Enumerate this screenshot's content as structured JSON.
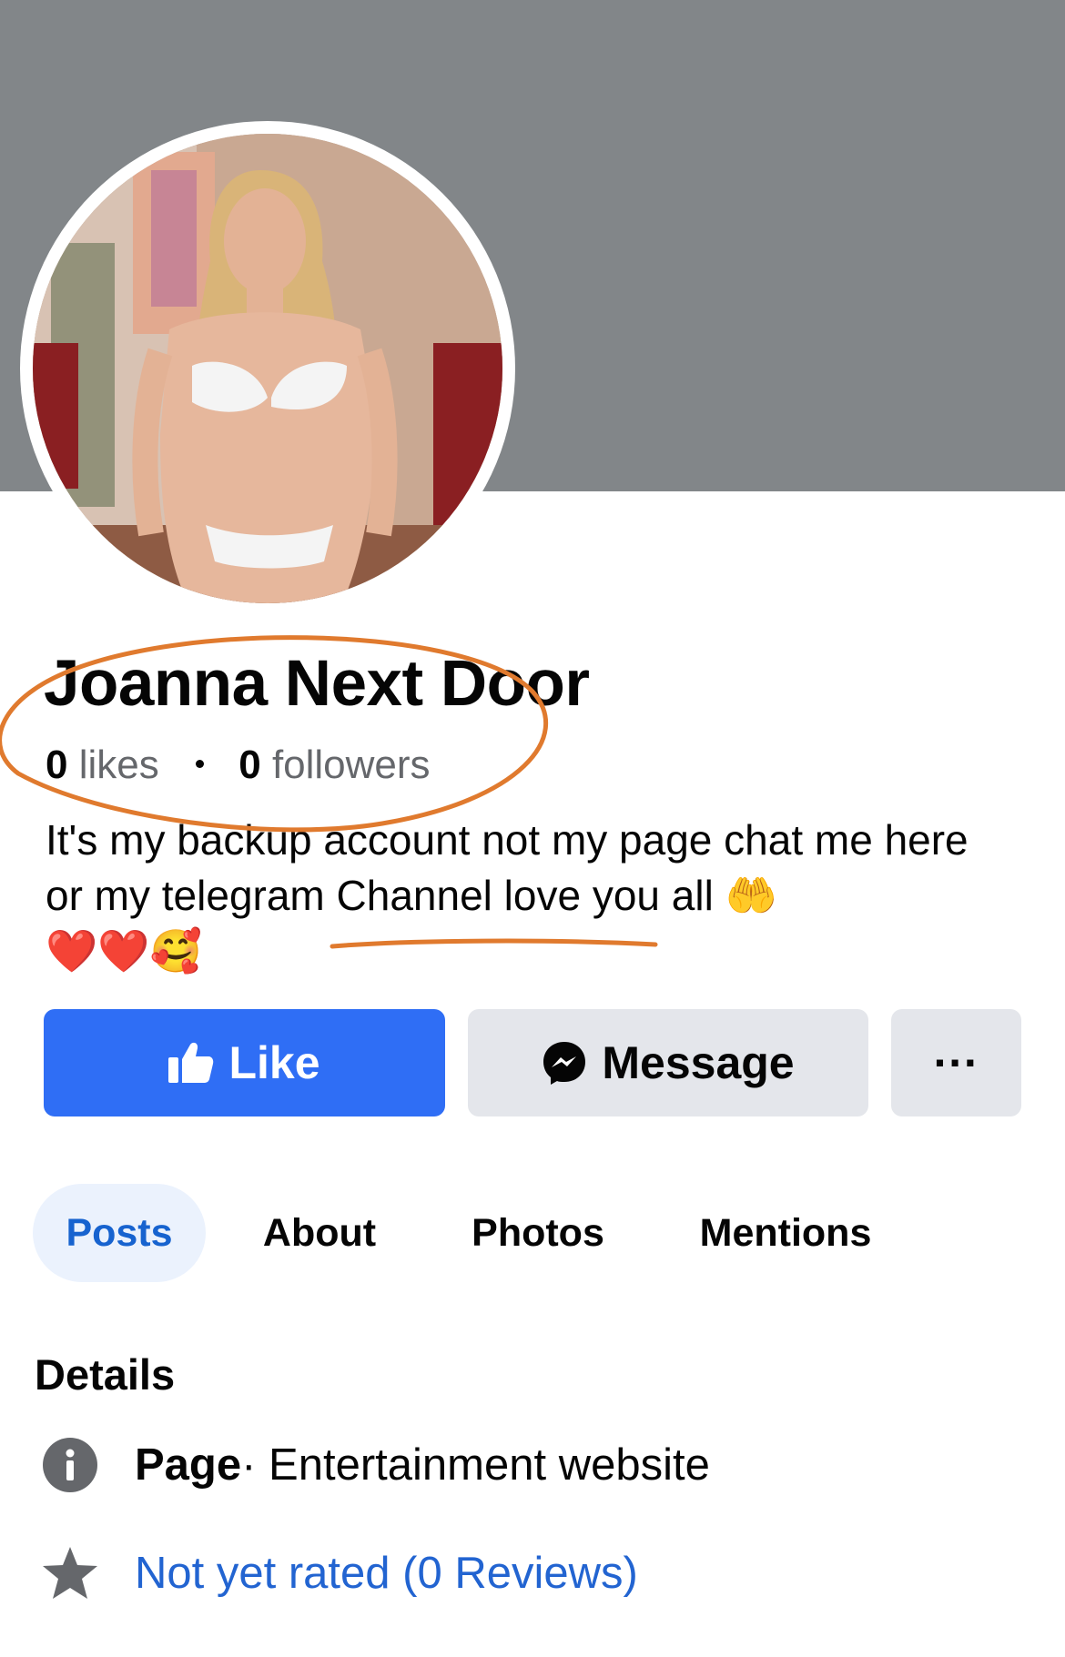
{
  "profile": {
    "name": "Joanna Next Door",
    "likes_count": "0",
    "likes_label": "likes",
    "followers_count": "0",
    "followers_label": "followers",
    "bio": "It's my backup account not my page chat me here or my telegram Channel love you all 🤲",
    "bio_emojis": "❤️❤️🥰"
  },
  "actions": {
    "like_label": "Like",
    "message_label": "Message",
    "more_label": "···"
  },
  "tabs": [
    {
      "label": "Posts",
      "active": true
    },
    {
      "label": "About",
      "active": false
    },
    {
      "label": "Photos",
      "active": false
    },
    {
      "label": "Mentions",
      "active": false
    }
  ],
  "details": {
    "title": "Details",
    "category_strong": "Page",
    "category_rest": " · Entertainment website",
    "rating_text": "Not yet rated (0 Reviews)"
  },
  "colors": {
    "cover": "#828689",
    "like_button": "#2f6ef5",
    "secondary_button": "#e4e6eb",
    "active_tab_bg": "#ebf2fd",
    "active_tab_text": "#1763cf",
    "link": "#2264d1",
    "annotation": "#e07a2e"
  },
  "icons": [
    "thumbs-up-icon",
    "messenger-icon",
    "ellipsis-icon",
    "info-icon",
    "star-icon"
  ]
}
